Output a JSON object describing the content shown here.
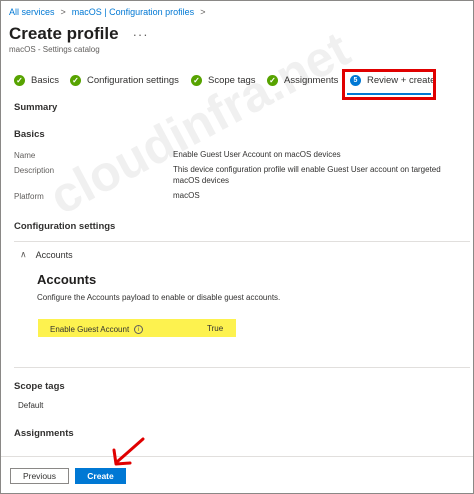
{
  "breadcrumb": {
    "items": [
      "All services",
      "macOS | Configuration profiles"
    ],
    "sep": ">"
  },
  "header": {
    "title": "Create profile",
    "more": "···",
    "subtitle": "macOS - Settings catalog"
  },
  "steps": [
    {
      "label": "Basics",
      "state": "done"
    },
    {
      "label": "Configuration settings",
      "state": "done"
    },
    {
      "label": "Scope tags",
      "state": "done"
    },
    {
      "label": "Assignments",
      "state": "done"
    },
    {
      "label": "Review + create",
      "state": "current",
      "number": "5"
    }
  ],
  "summary": {
    "heading": "Summary"
  },
  "basics": {
    "heading": "Basics",
    "rows": [
      {
        "key": "Name",
        "value": "Enable Guest User Account on macOS devices"
      },
      {
        "key": "Description",
        "value": "This device configuration profile will enable Guest User account on targeted",
        "value2": "macOS devices"
      },
      {
        "key": "Platform",
        "value": "macOS"
      }
    ]
  },
  "configuration": {
    "heading": "Configuration settings",
    "accordion_label": "Accounts",
    "accounts_title": "Accounts",
    "accounts_desc": "Configure the Accounts payload to enable or disable guest accounts.",
    "setting_label": "Enable Guest Account",
    "setting_value": "True"
  },
  "scope_tags": {
    "heading": "Scope tags",
    "value": "Default"
  },
  "assignments": {
    "heading": "Assignments"
  },
  "watermark": "cloudinfra.net",
  "footer": {
    "previous_label": "Previous",
    "create_label": "Create"
  },
  "colors": {
    "accent": "#0078d4",
    "check": "#57a300",
    "highlight": "#fdf24f",
    "annotation": "#e00000"
  }
}
